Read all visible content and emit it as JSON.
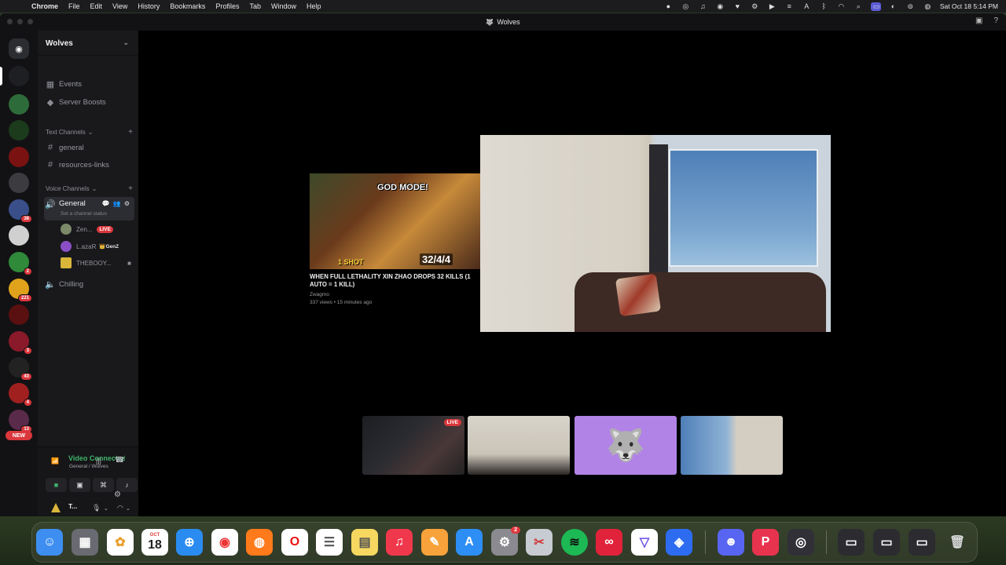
{
  "menubar": {
    "apple": "",
    "app_name": "Chrome",
    "items": [
      "File",
      "Edit",
      "View",
      "History",
      "Bookmarks",
      "Profiles",
      "Tab",
      "Window",
      "Help"
    ],
    "clock": "Sat Oct 18  5:14 PM"
  },
  "window": {
    "title": "Wolves"
  },
  "server": {
    "name": "Wolves",
    "events_label": "Events",
    "boosts_label": "Server Boosts",
    "text_category": "Text Channels",
    "text_channels": [
      "general",
      "resources-links"
    ],
    "voice_category": "Voice Channels",
    "voice_channels": [
      {
        "name": "General",
        "status": "Set a channel status",
        "members": [
          {
            "name": "Zen...",
            "tag": "LIVE",
            "avatar_color": "#7c8a6a"
          },
          {
            "name": "L.azaR",
            "tag": "GenZ",
            "avatar_color": "#8a4fc7"
          },
          {
            "name": "THEBOOY...",
            "tag": "",
            "avatar_color": "#d9b53a"
          }
        ]
      },
      {
        "name": "Chilling",
        "members": []
      }
    ]
  },
  "guilds": [
    {
      "name": "discord-home",
      "color": "#2b2d31",
      "badge": ""
    },
    {
      "name": "guild-wolves",
      "color": "#1e1f22",
      "badge": ""
    },
    {
      "name": "guild-green-swirl",
      "color": "#2e6b3a",
      "badge": ""
    },
    {
      "name": "guild-lgl",
      "color": "#1c3a1c",
      "badge": ""
    },
    {
      "name": "guild-circle",
      "color": "#7a1212",
      "badge": ""
    },
    {
      "name": "guild-squad",
      "color": "#3b3b40",
      "badge": ""
    },
    {
      "name": "guild-blue",
      "color": "#3a4f8a",
      "badge": "38"
    },
    {
      "name": "guild-skull",
      "color": "#d0d0d0",
      "badge": ""
    },
    {
      "name": "guild-greenmask",
      "color": "#2f8a3a",
      "badge": "2"
    },
    {
      "name": "guild-yellowtext",
      "color": "#e0a21a",
      "badge": "221"
    },
    {
      "name": "guild-red-logo",
      "color": "#5a1010",
      "badge": ""
    },
    {
      "name": "guild-pink",
      "color": "#8a1a2a",
      "badge": "3"
    },
    {
      "name": "guild-dark",
      "color": "#222",
      "badge": "43"
    },
    {
      "name": "guild-red2",
      "color": "#a02020",
      "badge": "4"
    },
    {
      "name": "guild-purple",
      "color": "#5a2a4a",
      "badge": "13"
    }
  ],
  "new_pill": "NEW",
  "voice_panel": {
    "label": "Video Connected",
    "sub": "General / Wolves"
  },
  "user_panel": {
    "name": "T...",
    "sub": ""
  },
  "stage": {
    "yt": {
      "overlay_godmode": "GOD MODE!",
      "overlay_1shot": "1 SHOT",
      "overlay_score": "32/4/4",
      "title": "WHEN FULL LETHALITY XIN ZHAO DROPS 32 KILLS (1 AUTO = 1 KILL)",
      "channel": "Zwagmo",
      "meta": "337 views • 15 minutes ago"
    },
    "thumbs": [
      {
        "name": "thumb-stream",
        "live": "LIVE"
      },
      {
        "name": "thumb-camera-person",
        "live": ""
      },
      {
        "name": "thumb-wolf-avatar",
        "live": ""
      },
      {
        "name": "thumb-room-camera",
        "live": ""
      }
    ]
  },
  "dock": {
    "calendar_month": "OCT",
    "calendar_day": "18",
    "settings_badge": "2",
    "items": [
      "Finder",
      "Launchpad",
      "Photos",
      "Calendar",
      "Safari",
      "Chrome",
      "Firefox",
      "Opera",
      "Reminders",
      "Notes",
      "Music",
      "Pages",
      "App Store",
      "System Settings",
      "Scissors",
      "Spotify",
      "Creative Cloud",
      "Vectorize",
      "Dashboard",
      "Discord",
      "Parsec",
      "OBS"
    ]
  },
  "colors": {
    "discord_bg": "#19191c",
    "rail_bg": "#121214",
    "live_red": "#da373c",
    "connected_green": "#3fb36a",
    "wolf_tile": "#b183e6"
  }
}
